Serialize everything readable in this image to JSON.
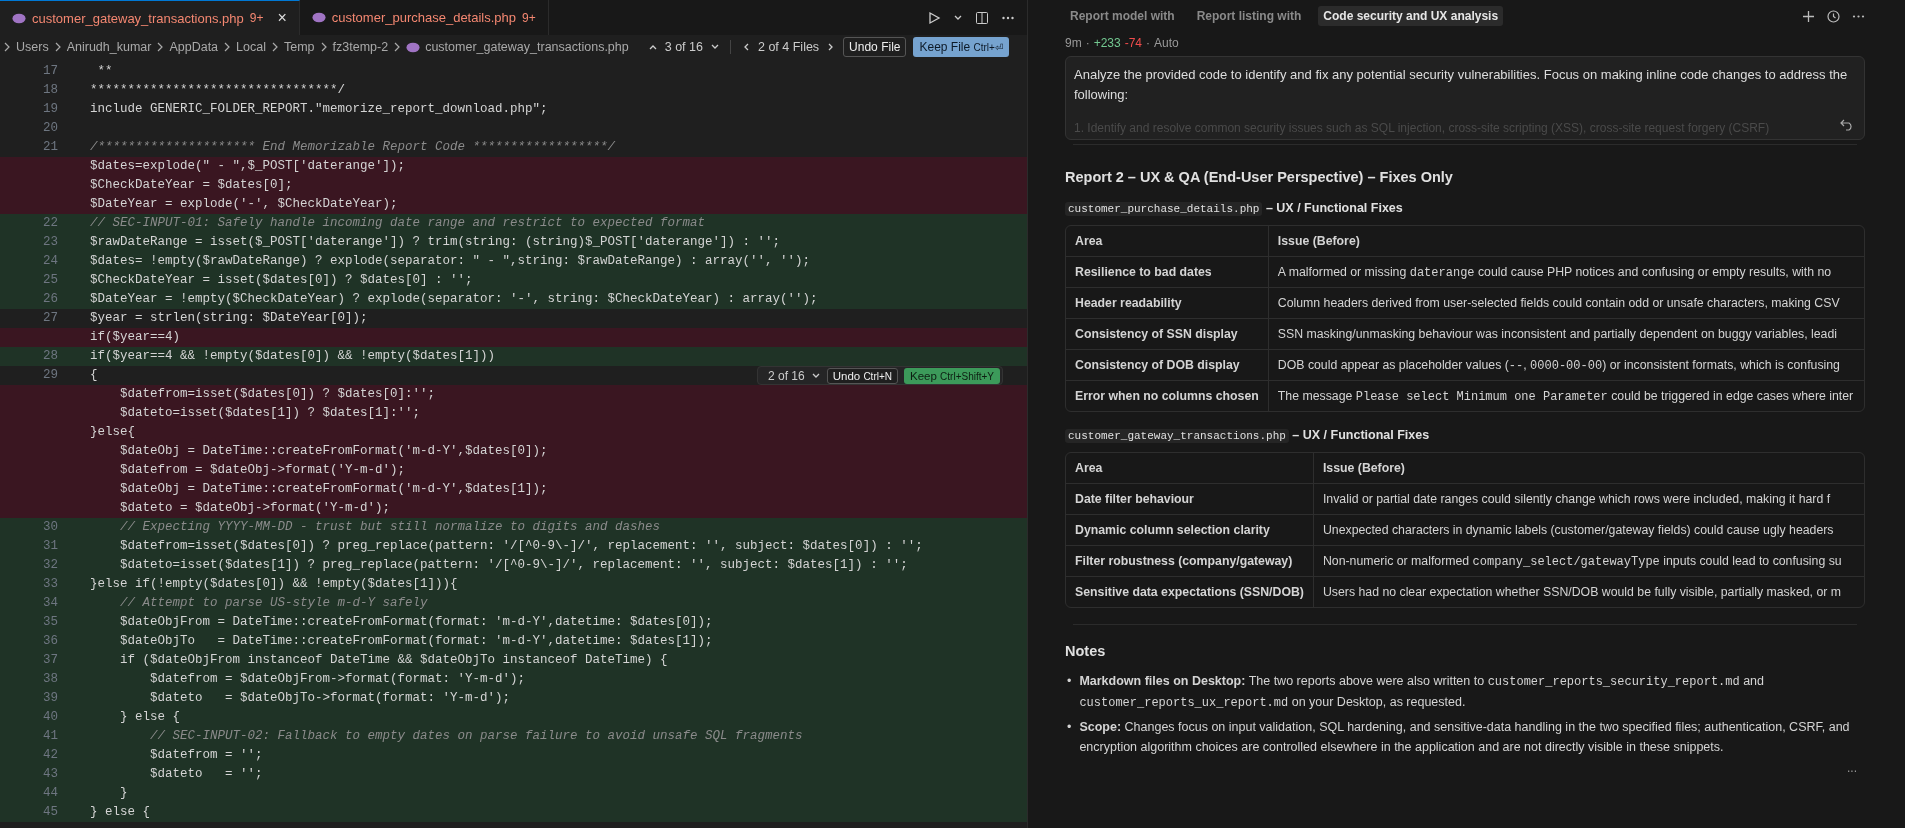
{
  "editor": {
    "tabs": [
      {
        "label": "customer_gateway_transactions.php",
        "badge": "9+",
        "selected": true,
        "close": "×"
      },
      {
        "label": "customer_purchase_details.php",
        "badge": "9+",
        "selected": false
      }
    ],
    "breadcrumb": [
      "Users",
      "Anirudh_kumar",
      "AppData",
      "Local",
      "Temp",
      "fz3temp-2",
      "customer_gateway_transactions.php"
    ],
    "change_counter": "3 of 16",
    "file_counter": "2 of 4 Files",
    "undo_file": "Undo File",
    "keep_file": {
      "label": "Keep File",
      "shortcut": "Ctrl+⏎"
    },
    "lines": [
      {
        "number": "17",
        "kind": "context",
        "comment": false,
        "text": " **"
      },
      {
        "number": "18",
        "kind": "context",
        "comment": false,
        "text": "*********************************/"
      },
      {
        "number": "19",
        "kind": "context",
        "comment": false,
        "text": "include GENERIC_FOLDER_REPORT.\"memorize_report_download.php\";"
      },
      {
        "number": "20",
        "kind": "context"
      },
      {
        "number": "21",
        "kind": "context",
        "comment": true,
        "text": "/********************* End Memorizable Report Code ******************/"
      },
      {
        "kind": "deleted",
        "comment": false,
        "text": "$dates=explode(\" - \",$_POST['daterange']);"
      },
      {
        "kind": "deleted",
        "comment": false,
        "text": "$CheckDateYear = $dates[0];"
      },
      {
        "kind": "deleted",
        "comment": false,
        "text": "$DateYear = explode('-', $CheckDateYear);"
      },
      {
        "number": "22",
        "kind": "added",
        "comment": true,
        "text": "// SEC-INPUT-01: Safely handle incoming date range and restrict to expected format"
      },
      {
        "number": "23",
        "kind": "added",
        "comment": false,
        "text": "$rawDateRange = isset($_POST['daterange']) ? trim(string: (string)$_POST['daterange']) : '';"
      },
      {
        "number": "24",
        "kind": "added",
        "comment": false,
        "text": "$dates= !empty($rawDateRange) ? explode(separator: \" - \",string: $rawDateRange) : array('', '');"
      },
      {
        "number": "25",
        "kind": "added",
        "comment": false,
        "text": "$CheckDateYear = isset($dates[0]) ? $dates[0] : '';"
      },
      {
        "number": "26",
        "kind": "added",
        "comment": false,
        "text": "$DateYear = !empty($CheckDateYear) ? explode(separator: '-', string: $CheckDateYear) : array('');"
      },
      {
        "number": "27",
        "kind": "context",
        "comment": false,
        "text": "$year = strlen(string: $DateYear[0]);"
      },
      {
        "kind": "deleted",
        "comment": false,
        "text": "if($year==4)"
      },
      {
        "number": "28",
        "kind": "added",
        "comment": false,
        "text": "if($year==4 && !empty($dates[0]) && !empty($dates[1]))"
      },
      {
        "number": "29",
        "kind": "context",
        "comment": false,
        "text": "{"
      },
      {
        "kind": "deleted",
        "comment": false,
        "text": "    $datefrom=isset($dates[0]) ? $dates[0]:'';"
      },
      {
        "kind": "deleted",
        "comment": false,
        "text": "    $dateto=isset($dates[1]) ? $dates[1]:'';"
      },
      {
        "kind": "deleted",
        "comment": false,
        "text": "}else{"
      },
      {
        "kind": "deleted",
        "comment": false,
        "text": "    $dateObj = DateTime::createFromFormat('m-d-Y',$dates[0]);"
      },
      {
        "kind": "deleted",
        "comment": false,
        "text": "    $datefrom = $dateObj->format('Y-m-d');"
      },
      {
        "kind": "deleted",
        "comment": false,
        "text": "    $dateObj = DateTime::createFromFormat('m-d-Y',$dates[1]);"
      },
      {
        "kind": "deleted",
        "comment": false,
        "text": "    $dateto = $dateObj->format('Y-m-d');"
      },
      {
        "number": "30",
        "kind": "added",
        "comment": true,
        "text": "    // Expecting YYYY-MM-DD - trust but still normalize to digits and dashes"
      },
      {
        "number": "31",
        "kind": "added",
        "comment": false,
        "text": "    $datefrom=isset($dates[0]) ? preg_replace(pattern: '/[^0-9\\-]/', replacement: '', subject: $dates[0]) : '';"
      },
      {
        "number": "32",
        "kind": "added",
        "comment": false,
        "text": "    $dateto=isset($dates[1]) ? preg_replace(pattern: '/[^0-9\\-]/', replacement: '', subject: $dates[1]) : '';"
      },
      {
        "number": "33",
        "kind": "added",
        "comment": false,
        "text": "}else if(!empty($dates[0]) && !empty($dates[1])){"
      },
      {
        "number": "34",
        "kind": "added",
        "comment": true,
        "text": "    // Attempt to parse US-style m-d-Y safely"
      },
      {
        "number": "35",
        "kind": "added",
        "comment": false,
        "text": "    $dateObjFrom = DateTime::createFromFormat(format: 'm-d-Y',datetime: $dates[0]);"
      },
      {
        "number": "36",
        "kind": "added",
        "comment": false,
        "text": "    $dateObjTo   = DateTime::createFromFormat(format: 'm-d-Y',datetime: $dates[1]);"
      },
      {
        "number": "37",
        "kind": "added",
        "comment": false,
        "text": "    if ($dateObjFrom instanceof DateTime && $dateObjTo instanceof DateTime) {"
      },
      {
        "number": "38",
        "kind": "added",
        "comment": false,
        "text": "        $datefrom = $dateObjFrom->format(format: 'Y-m-d');"
      },
      {
        "number": "39",
        "kind": "added",
        "comment": false,
        "text": "        $dateto   = $dateObjTo->format(format: 'Y-m-d');"
      },
      {
        "number": "40",
        "kind": "added",
        "comment": false,
        "text": "    } else {"
      },
      {
        "number": "41",
        "kind": "added",
        "comment": true,
        "text": "        // SEC-INPUT-02: Fallback to empty dates on parse failure to avoid unsafe SQL fragments"
      },
      {
        "number": "42",
        "kind": "added",
        "comment": false,
        "text": "        $datefrom = '';"
      },
      {
        "number": "43",
        "kind": "added",
        "comment": false,
        "text": "        $dateto   = '';"
      },
      {
        "number": "44",
        "kind": "added",
        "comment": false,
        "text": "    }"
      },
      {
        "number": "45",
        "kind": "added",
        "comment": false,
        "text": "} else {"
      }
    ],
    "inline_review": {
      "counter": "2 of 16",
      "undo": {
        "label": "Undo",
        "shortcut": "Ctrl+N"
      },
      "keep": {
        "label": "Keep",
        "shortcut": "Ctrl+Shift+Y"
      }
    }
  },
  "chat": {
    "tabs": [
      {
        "label": "Report model with",
        "selected": false
      },
      {
        "label": "Report listing with",
        "selected": false
      },
      {
        "label": "Code security and UX analysis",
        "selected": true
      }
    ],
    "meta": {
      "age": "9m",
      "dot_1": "·",
      "added": "+233",
      "removed": "-74",
      "dot_2": "·",
      "mode": "Auto"
    },
    "prompt": {
      "text": "Analyze the provided code to identify and fix any potential security vulnerabilities. Focus on making inline code changes to address the following:",
      "faded": "1. Identify and resolve common security issues such as SQL injection, cross-site scripting (XSS), cross-site request forgery (CSRF)"
    },
    "report_title": "Report 2 – UX & QA (End-User Perspective) – Fixes Only",
    "sections": [
      {
        "heading": [
          {
            "kind": "code",
            "text": "customer_purchase_details.php"
          },
          {
            "kind": "text",
            "text": " – UX / Functional Fixes"
          }
        ],
        "columns": [
          "Area",
          "Issue (Before)"
        ],
        "rows": [
          {
            "area": "Resilience to bad dates",
            "issue": [
              {
                "kind": "text",
                "text": "A malformed or missing "
              },
              {
                "kind": "code",
                "text": "daterange"
              },
              {
                "kind": "text",
                "text": " could cause PHP notices and confusing or empty results, with no"
              }
            ]
          },
          {
            "area": "Header readability",
            "issue": [
              {
                "kind": "text",
                "text": "Column headers derived from user-selected fields could contain odd or unsafe characters, making CSV"
              }
            ]
          },
          {
            "area": "Consistency of SSN display",
            "issue": [
              {
                "kind": "text",
                "text": "SSN masking/unmasking behaviour was inconsistent and partially dependent on buggy variables, leadi"
              }
            ]
          },
          {
            "area": "Consistency of DOB display",
            "issue": [
              {
                "kind": "text",
                "text": "DOB could appear as placeholder values ("
              },
              {
                "kind": "code",
                "text": "--"
              },
              {
                "kind": "text",
                "text": ", "
              },
              {
                "kind": "code",
                "text": "0000-00-00"
              },
              {
                "kind": "text",
                "text": ") or inconsistent formats, which is confusing"
              }
            ]
          },
          {
            "area": "Error when no columns chosen",
            "issue": [
              {
                "kind": "text",
                "text": "The message "
              },
              {
                "kind": "code",
                "text": "Please select Minimum one Parameter"
              },
              {
                "kind": "text",
                "text": " could be triggered in edge cases where inter"
              }
            ]
          }
        ]
      },
      {
        "heading": [
          {
            "kind": "code",
            "text": "customer_gateway_transactions.php"
          },
          {
            "kind": "text",
            "text": " – UX / Functional Fixes"
          }
        ],
        "columns": [
          "Area",
          "Issue (Before)"
        ],
        "rows": [
          {
            "area": "Date filter behaviour",
            "issue": [
              {
                "kind": "text",
                "text": "Invalid or partial date ranges could silently change which rows were included, making it hard f"
              }
            ]
          },
          {
            "area": "Dynamic column selection clarity",
            "issue": [
              {
                "kind": "text",
                "text": "Unexpected characters in dynamic labels (customer/gateway fields) could cause ugly headers"
              }
            ]
          },
          {
            "area": "Filter robustness (company/gateway)",
            "issue": [
              {
                "kind": "text",
                "text": "Non-numeric or malformed "
              },
              {
                "kind": "code",
                "text": "company_select/gatewayType"
              },
              {
                "kind": "text",
                "text": " inputs could lead to confusing su"
              }
            ]
          },
          {
            "area": "Sensitive data expectations (SSN/DOB)",
            "issue": [
              {
                "kind": "text",
                "text": "Users had no clear expectation whether SSN/DOB would be fully visible, partially masked, or m"
              }
            ]
          }
        ]
      }
    ],
    "notes": {
      "heading": "Notes",
      "items": [
        {
          "marker": "•",
          "lead": "Markdown files on Desktop:",
          "parts": [
            {
              "kind": "text",
              "text": " The two reports above were also written to "
            },
            {
              "kind": "code",
              "text": "customer_reports_security_report.md"
            },
            {
              "kind": "text",
              "text": " and "
            },
            {
              "kind": "code",
              "text": "customer_reports_ux_report.md"
            },
            {
              "kind": "text",
              "text": " on your Desktop, as requested."
            }
          ]
        },
        {
          "marker": "•",
          "lead": "Scope:",
          "parts": [
            {
              "kind": "text",
              "text": " Changes focus on input validation, SQL hardening, and sensitive-data handling in the two specified files; authentication, CSRF, and encryption algorithm choices are controlled elsewhere in the application and are not directly visible in these snippets."
            }
          ]
        }
      ]
    },
    "more": "..."
  }
}
